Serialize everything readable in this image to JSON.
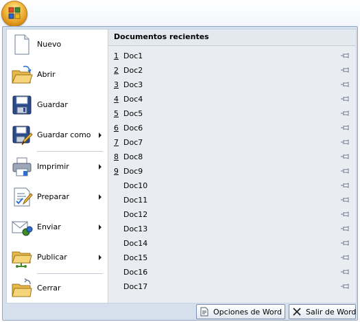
{
  "menu": {
    "items": [
      {
        "label": "Nuevo",
        "icon": "new-document-icon",
        "submenu": false
      },
      {
        "label": "Abrir",
        "icon": "open-folder-icon",
        "submenu": false
      },
      {
        "label": "Guardar",
        "icon": "save-disk-icon",
        "submenu": false
      },
      {
        "label": "Guardar como",
        "icon": "save-as-icon",
        "submenu": true
      },
      {
        "label": "Imprimir",
        "icon": "printer-icon",
        "submenu": true
      },
      {
        "label": "Preparar",
        "icon": "prepare-document-icon",
        "submenu": true
      },
      {
        "label": "Enviar",
        "icon": "send-mail-icon",
        "submenu": true
      },
      {
        "label": "Publicar",
        "icon": "publish-folder-icon",
        "submenu": true
      },
      {
        "label": "Cerrar",
        "icon": "close-folder-icon",
        "submenu": false
      }
    ]
  },
  "recent": {
    "title": "Documentos recientes",
    "items": [
      {
        "num": "1",
        "name": "Doc1"
      },
      {
        "num": "2",
        "name": "Doc2"
      },
      {
        "num": "3",
        "name": "Doc3"
      },
      {
        "num": "4",
        "name": "Doc4"
      },
      {
        "num": "5",
        "name": "Doc5"
      },
      {
        "num": "6",
        "name": "Doc6"
      },
      {
        "num": "7",
        "name": "Doc7"
      },
      {
        "num": "8",
        "name": "Doc8"
      },
      {
        "num": "9",
        "name": "Doc9"
      },
      {
        "num": "",
        "name": "Doc10"
      },
      {
        "num": "",
        "name": "Doc11"
      },
      {
        "num": "",
        "name": "Doc12"
      },
      {
        "num": "",
        "name": "Doc13"
      },
      {
        "num": "",
        "name": "Doc14"
      },
      {
        "num": "",
        "name": "Doc15"
      },
      {
        "num": "",
        "name": "Doc16"
      },
      {
        "num": "",
        "name": "Doc17"
      }
    ]
  },
  "footer": {
    "options_label": "Opciones de Word",
    "exit_label": "Salir de Word"
  },
  "colors": {
    "frame": "#d6dfec",
    "recent_bg": "#e9edf2",
    "accent": "#f6c04a"
  }
}
